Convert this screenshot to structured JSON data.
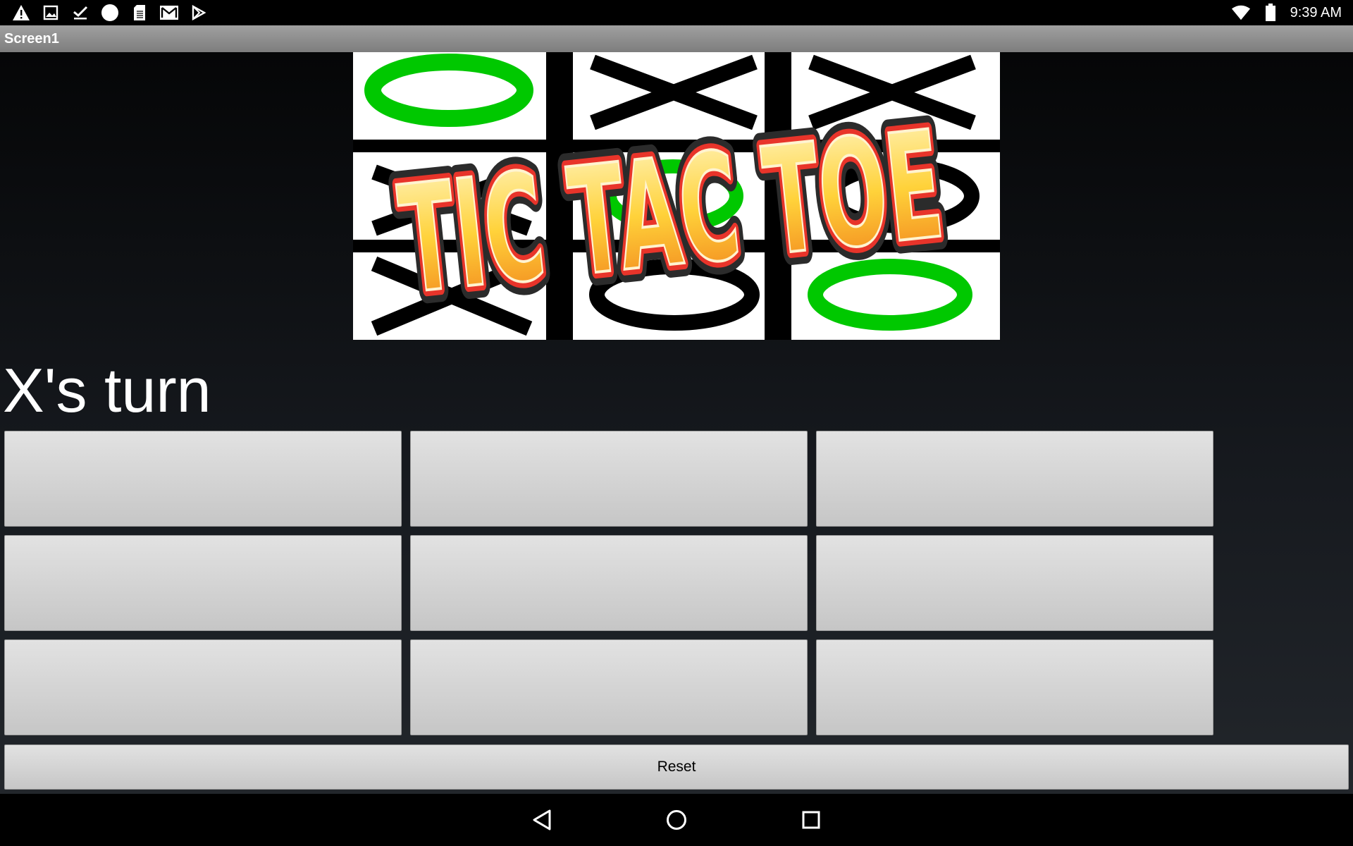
{
  "status_bar": {
    "time": "9:39 AM",
    "left_icons": [
      "warning-icon",
      "image-icon",
      "check-icon",
      "circle-icon",
      "sd-card-icon",
      "gmail-icon",
      "play-store-icon"
    ],
    "right_icons": [
      "wifi-icon",
      "battery-icon"
    ]
  },
  "title_bar": {
    "title": "Screen1"
  },
  "logo": {
    "text": "TIC TAC TOE",
    "colors": {
      "fill_top": "#fff7c0",
      "fill_bottom": "#f07a18",
      "outline": "#e8342a",
      "green": "#00c800"
    }
  },
  "game": {
    "turn_text": "X's turn",
    "cells": [
      "",
      "",
      "",
      "",
      "",
      "",
      "",
      "",
      ""
    ]
  },
  "reset_label": "Reset",
  "nav_bar": {
    "buttons": [
      "back-icon",
      "home-icon",
      "recents-icon"
    ]
  }
}
